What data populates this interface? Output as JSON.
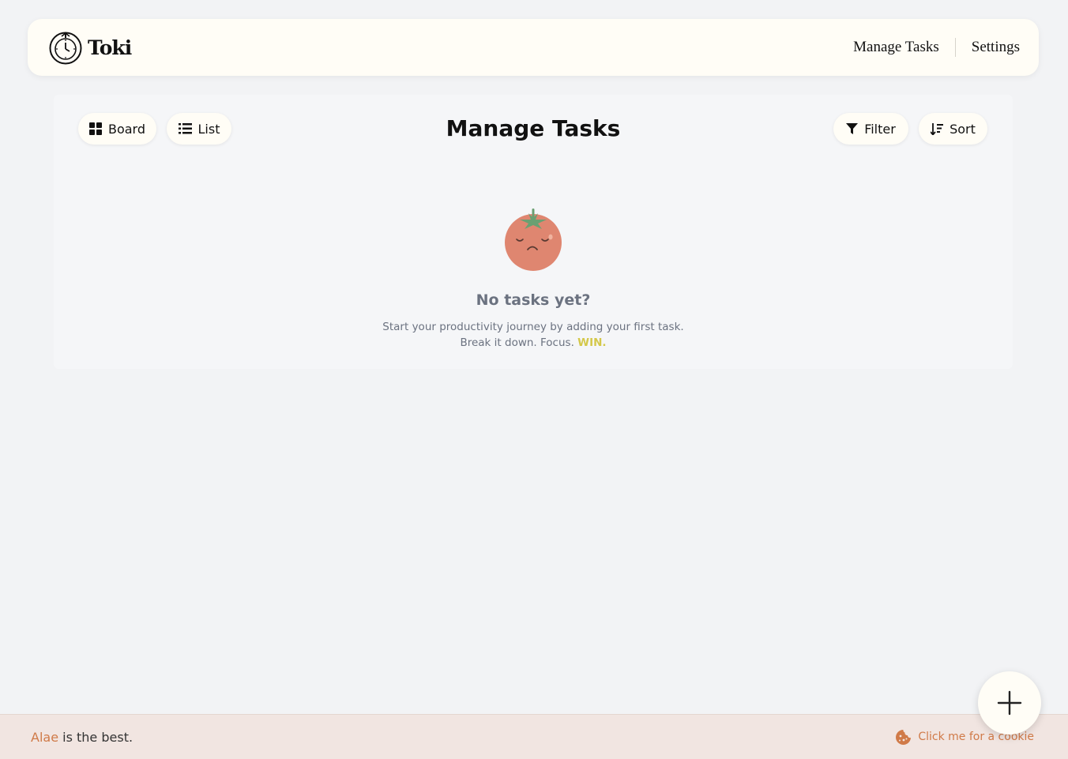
{
  "header": {
    "app_name": "Toki",
    "logo_icon": "stopwatch-icon",
    "nav": [
      {
        "label": "Manage Tasks"
      },
      {
        "label": "Settings"
      }
    ]
  },
  "toolbar": {
    "board_label": "Board",
    "board_icon": "grid-icon",
    "list_label": "List",
    "list_icon": "list-icon",
    "filter_label": "Filter",
    "filter_icon": "filter-icon",
    "sort_label": "Sort",
    "sort_icon": "sort-icon"
  },
  "main": {
    "title": "Manage Tasks",
    "empty_state": {
      "illustration": "sad-tomato",
      "heading": "No tasks yet?",
      "line1": "Start your productivity journey by adding your first task.",
      "line2_prefix": "Break it down. Focus.",
      "line2_emphasis": "WIN."
    }
  },
  "footer": {
    "name": "Alae",
    "text": "is the best.",
    "cookie_label": "Click me for a cookie",
    "cookie_icon": "cookie-icon"
  },
  "fab": {
    "icon": "plus-icon"
  },
  "colors": {
    "accent": "#d07a48",
    "win": "#d4c84a",
    "background": "#f2f3f5",
    "card": "#fffdf6",
    "footer_bg": "#f1e5e1",
    "tomato": "#df8670",
    "leaf": "#6aa072"
  }
}
